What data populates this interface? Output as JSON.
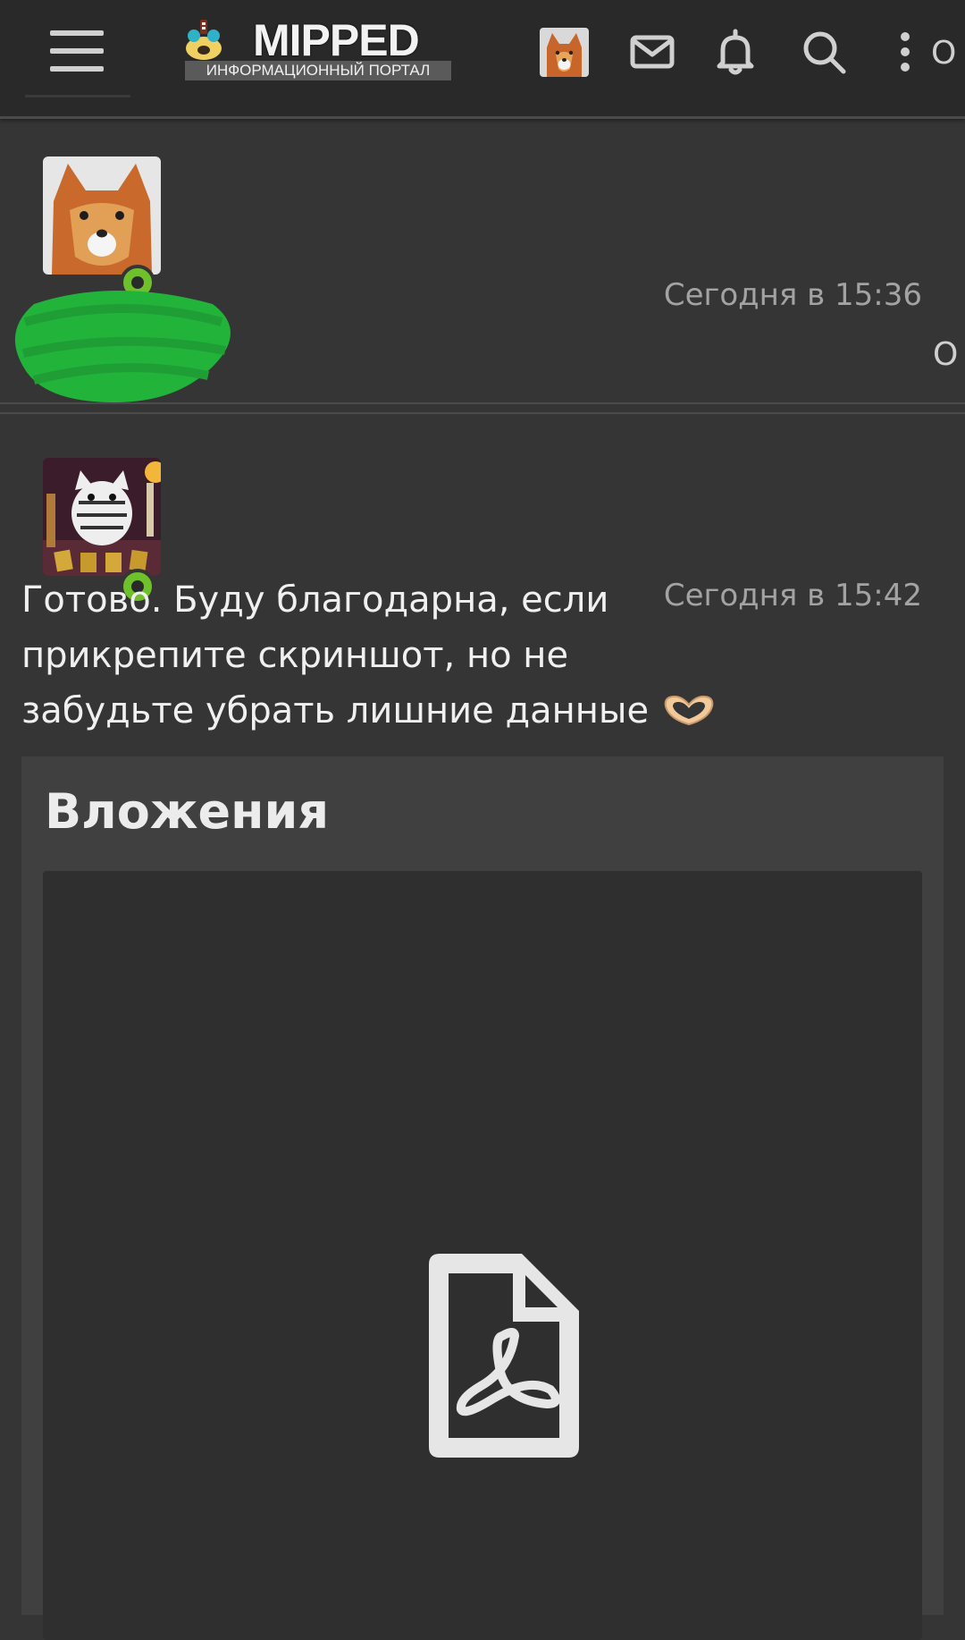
{
  "header": {
    "logo_title": "MIPPED",
    "logo_subtitle": "ИНФОРМАЦИОННЫЙ ПОРТАЛ",
    "overflow_text": "О",
    "icons": [
      "menu-icon",
      "envelope-icon",
      "bell-icon",
      "search-icon",
      "more-vertical-icon"
    ]
  },
  "messages": [
    {
      "timestamp": "Сегодня в 15:36",
      "overflow_text": "О",
      "avatar": "fox-avatar",
      "online": true
    },
    {
      "timestamp": "Сегодня в 15:42",
      "avatar": "cat-tarot-avatar",
      "online": true,
      "text": "Готово. Буду благодарна, если прикрепите скриншот, но не забудьте убрать лишние данные",
      "emoji": "heart-hands-emoji",
      "attachments": {
        "title": "Вложения",
        "files": [
          {
            "icon": "pdf-file-icon"
          }
        ]
      }
    }
  ],
  "colors": {
    "page_bg": "#353535",
    "topbar_bg": "#292929",
    "online": "#6ec12b",
    "redaction": "#22b33b",
    "timestamp": "#a3a3a3"
  }
}
